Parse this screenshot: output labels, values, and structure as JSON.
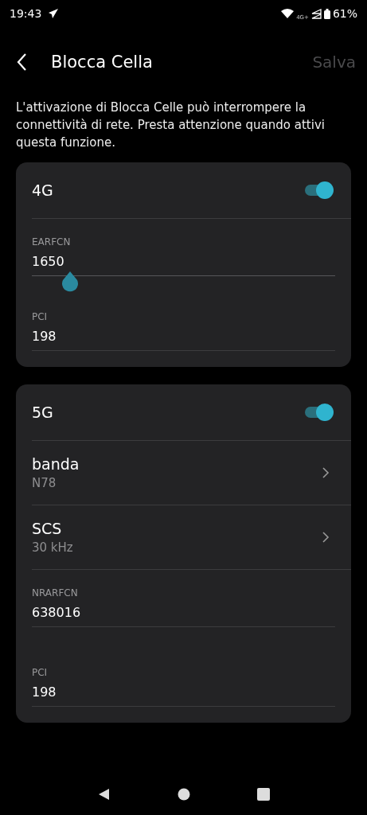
{
  "status_bar": {
    "time": "19:43",
    "network": "4G+",
    "battery": "61%"
  },
  "header": {
    "title": "Blocca Cella",
    "action": {
      "label": "Salva",
      "disabled": true
    }
  },
  "description": "L'attivazione di Blocca Celle può interrompere la connettività di rete. Presta attenzione quando attivi questa funzione.",
  "sections": [
    {
      "items": [
        {
          "kind": "toggle",
          "label": "4G",
          "on": true
        },
        {
          "kind": "field",
          "label": "EARFCN",
          "value": "1650",
          "focused": true
        },
        {
          "kind": "field",
          "label": "PCI",
          "value": "198",
          "focused": false
        }
      ]
    },
    {
      "items": [
        {
          "kind": "toggle",
          "label": "5G",
          "on": true
        },
        {
          "kind": "picker",
          "label": "banda",
          "value": "N78"
        },
        {
          "kind": "picker",
          "label": "SCS",
          "value": "30 kHz"
        },
        {
          "kind": "field",
          "label": "NRARFCN",
          "value": "638016",
          "focused": false
        },
        {
          "kind": "field",
          "label": "PCI",
          "value": "198",
          "focused": false
        }
      ]
    }
  ]
}
